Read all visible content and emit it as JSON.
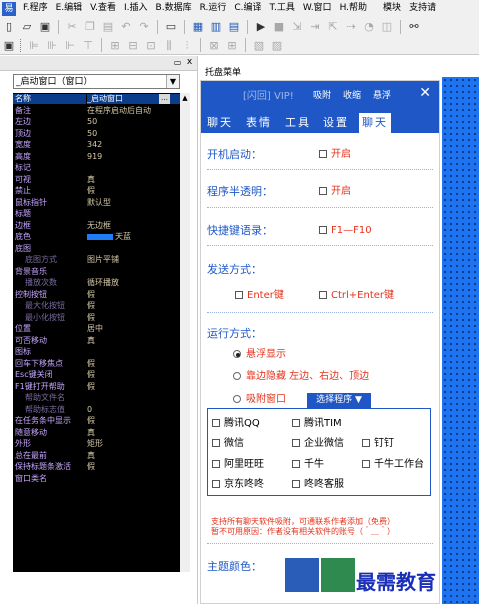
{
  "menubar": {
    "items": [
      "F.程序",
      "E.编辑",
      "V.查看",
      "I.插入",
      "B.数据库",
      "R.运行",
      "C.编译",
      "T.工具",
      "W.窗口",
      "H.帮助",
      "模块",
      "支持请"
    ]
  },
  "toolbar1": {
    "icons": [
      "new-file-icon",
      "open-folder-icon",
      "save-icon",
      "cut-icon",
      "copy-icon",
      "paste-icon",
      "undo-icon",
      "redo-icon",
      "form-icon",
      "window-layout-icon",
      "split-layout-icon",
      "list-layout-icon",
      "run-icon",
      "stop-icon",
      "step-icons",
      "binoculars-icon"
    ]
  },
  "left_panel": {
    "pin": "▭",
    "close": "x",
    "selector_value": "_启动窗口（窗口）",
    "properties": [
      {
        "k": "名称",
        "v": "_启动窗口",
        "sel": true
      },
      {
        "k": "备注",
        "v": "在程序启动后自动"
      },
      {
        "k": "左边",
        "v": "50"
      },
      {
        "k": "顶边",
        "v": "50"
      },
      {
        "k": "宽度",
        "v": "342"
      },
      {
        "k": "高度",
        "v": "919"
      },
      {
        "k": "标记",
        "v": ""
      },
      {
        "k": "可视",
        "v": "真"
      },
      {
        "k": "禁止",
        "v": "假"
      },
      {
        "k": "鼠标指针",
        "v": "默认型"
      },
      {
        "k": "标题",
        "v": ""
      },
      {
        "k": "边框",
        "v": "无边框"
      },
      {
        "k": "底色",
        "v": "天蓝",
        "swatch": true
      },
      {
        "k": "底图",
        "v": ""
      },
      {
        "k": "底图方式",
        "v": "图片平铺",
        "child": true
      },
      {
        "k": "背景音乐",
        "v": ""
      },
      {
        "k": "播放次数",
        "v": "循环播放",
        "child": true
      },
      {
        "k": "控制按钮",
        "v": "假"
      },
      {
        "k": "最大化按钮",
        "v": "假",
        "child": true
      },
      {
        "k": "最小化按钮",
        "v": "假",
        "child": true
      },
      {
        "k": "位置",
        "v": "居中"
      },
      {
        "k": "可否移动",
        "v": "真"
      },
      {
        "k": "图标",
        "v": ""
      },
      {
        "k": "回车下移焦点",
        "v": "假"
      },
      {
        "k": "Esc键关闭",
        "v": "假"
      },
      {
        "k": "F1键打开帮助",
        "v": "假"
      },
      {
        "k": "帮助文件名",
        "v": "",
        "child": true
      },
      {
        "k": "帮助标志值",
        "v": "0",
        "child": true
      },
      {
        "k": "在任务条中显示",
        "v": "假"
      },
      {
        "k": "随意移动",
        "v": "真"
      },
      {
        "k": "外形",
        "v": "矩形"
      },
      {
        "k": "总在最前",
        "v": "真"
      },
      {
        "k": "保持标题条激活",
        "v": "假"
      },
      {
        "k": "窗口类名",
        "v": ""
      }
    ]
  },
  "design": {
    "tray_label": "托盘菜单",
    "window": {
      "title": "[闪回] VIP!",
      "controls": [
        "吸附",
        "收缩",
        "悬浮"
      ],
      "close": "✕",
      "tabs": [
        "聊天",
        "表情",
        "工具",
        "设置",
        "聊天"
      ],
      "startup_label": "开机启动：",
      "startup_option": "开启",
      "transparent_label": "程序半透明：",
      "transparent_option": "开启",
      "hotkey_label": "快捷键语录：",
      "hotkey_option": "F1—F10",
      "send_label": "发送方式：",
      "send_options": [
        "Enter键",
        "Ctrl+Enter键"
      ],
      "run_label": "运行方式：",
      "run_options": [
        "悬浮显示",
        "靠边隐藏 左边、右边、顶边",
        "吸附窗口"
      ],
      "select_button": "选择程序 ▼",
      "software": [
        "腾讯QQ",
        "腾讯TIM",
        "微信",
        "企业微信",
        "钉钉",
        "阿里旺旺",
        "千牛",
        "千牛工作台",
        "京东咚咚",
        "咚咚客服"
      ],
      "notice_line1": "支持所有聊天软件吸附，可通联系作者添加（免费）",
      "notice_line2": "暂不可用原因：作者没有相关软件的账号（＾＿＾）",
      "theme_label": "主题颜色：",
      "theme_colors": [
        "#2a5db8",
        "#2e8a4e"
      ]
    }
  },
  "watermark": "最需教育"
}
